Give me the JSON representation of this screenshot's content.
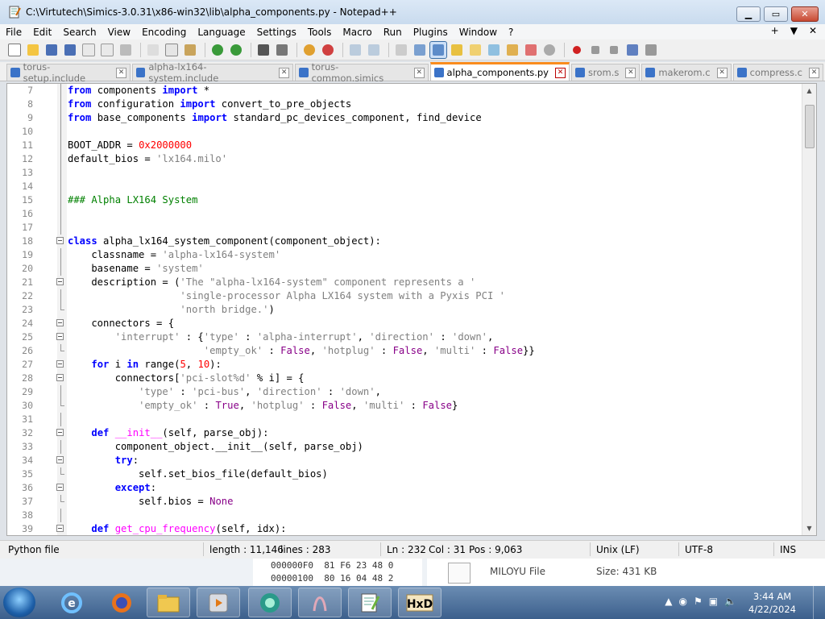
{
  "window": {
    "title": "C:\\Virtutech\\Simics-3.0.31\\x86-win32\\lib\\alpha_components.py - Notepad++"
  },
  "menu": [
    "File",
    "Edit",
    "Search",
    "View",
    "Encoding",
    "Language",
    "Settings",
    "Tools",
    "Macro",
    "Run",
    "Plugins",
    "Window",
    "?"
  ],
  "menu_right": [
    "+",
    "▼",
    "✕"
  ],
  "tabs": [
    {
      "label": "torus-setup.include",
      "active": false
    },
    {
      "label": "alpha-lx164-system.include",
      "active": false
    },
    {
      "label": "torus-common.simics",
      "active": false
    },
    {
      "label": "alpha_components.py",
      "active": true
    },
    {
      "label": "srom.s",
      "active": false
    },
    {
      "label": "makerom.c",
      "active": false
    },
    {
      "label": "compress.c",
      "active": false
    }
  ],
  "editor": {
    "lines": [
      {
        "n": "7",
        "fold": "line",
        "html": "<span class=\"kw\">from</span> components <span class=\"kw\">import</span> *"
      },
      {
        "n": "8",
        "fold": "line",
        "html": "<span class=\"kw\">from</span> configuration <span class=\"kw\">import</span> convert_to_pre_objects"
      },
      {
        "n": "9",
        "fold": "line",
        "html": "<span class=\"kw\">from</span> base_components <span class=\"kw\">import</span> standard_pc_devices_component, find_device"
      },
      {
        "n": "10",
        "fold": "line",
        "html": ""
      },
      {
        "n": "11",
        "fold": "line",
        "html": "BOOT_ADDR = <span class=\"num\">0x2000000</span>"
      },
      {
        "n": "12",
        "fold": "line",
        "html": "default_bios = <span class=\"str\">'lx164.milo'</span>"
      },
      {
        "n": "13",
        "fold": "line",
        "html": ""
      },
      {
        "n": "14",
        "fold": "line",
        "html": ""
      },
      {
        "n": "15",
        "fold": "line",
        "html": "<span class=\"cm\">### Alpha LX164 System</span>"
      },
      {
        "n": "16",
        "fold": "line",
        "html": ""
      },
      {
        "n": "17",
        "fold": "line",
        "html": ""
      },
      {
        "n": "18",
        "fold": "box",
        "html": "<span class=\"kw\">class</span> alpha_lx164_system_component(component_object):"
      },
      {
        "n": "19",
        "fold": "line",
        "html": "    classname = <span class=\"str\">'alpha-lx164-system'</span>"
      },
      {
        "n": "20",
        "fold": "line",
        "html": "    basename = <span class=\"str\">'system'</span>"
      },
      {
        "n": "21",
        "fold": "box",
        "html": "    description = (<span class=\"str\">'The \"alpha-lx164-system\" component represents a '</span>"
      },
      {
        "n": "22",
        "fold": "line",
        "html": "                   <span class=\"str\">'single-processor Alpha LX164 system with a Pyxis PCI '</span>"
      },
      {
        "n": "23",
        "fold": "end",
        "html": "                   <span class=\"str\">'north bridge.'</span>)"
      },
      {
        "n": "24",
        "fold": "box",
        "html": "    connectors = {"
      },
      {
        "n": "25",
        "fold": "box",
        "html": "        <span class=\"str\">'interrupt'</span> : {<span class=\"str\">'type'</span> : <span class=\"str\">'alpha-interrupt'</span>, <span class=\"str\">'direction'</span> : <span class=\"str\">'down'</span>,"
      },
      {
        "n": "26",
        "fold": "end",
        "html": "                       <span class=\"str\">'empty_ok'</span> : <span class=\"bool\">False</span>, <span class=\"str\">'hotplug'</span> : <span class=\"bool\">False</span>, <span class=\"str\">'multi'</span> : <span class=\"bool\">False</span>}}"
      },
      {
        "n": "27",
        "fold": "box",
        "html": "    <span class=\"kw\">for</span> i <span class=\"kw\">in</span> range(<span class=\"num\">5</span>, <span class=\"num\">10</span>):"
      },
      {
        "n": "28",
        "fold": "box",
        "html": "        connectors[<span class=\"str\">'pci-slot%d'</span> % i] = {"
      },
      {
        "n": "29",
        "fold": "line",
        "html": "            <span class=\"str\">'type'</span> : <span class=\"str\">'pci-bus'</span>, <span class=\"str\">'direction'</span> : <span class=\"str\">'down'</span>,"
      },
      {
        "n": "30",
        "fold": "end",
        "html": "            <span class=\"str\">'empty_ok'</span> : <span class=\"bool\">True</span>, <span class=\"str\">'hotplug'</span> : <span class=\"bool\">False</span>, <span class=\"str\">'multi'</span> : <span class=\"bool\">False</span>}"
      },
      {
        "n": "31",
        "fold": "line",
        "html": ""
      },
      {
        "n": "32",
        "fold": "box",
        "html": "    <span class=\"kw\">def</span> <span class=\"func\">__init__</span>(self, parse_obj):"
      },
      {
        "n": "33",
        "fold": "line",
        "html": "        component_object.__init__(self, parse_obj)"
      },
      {
        "n": "34",
        "fold": "box",
        "html": "        <span class=\"kw\">try</span>:"
      },
      {
        "n": "35",
        "fold": "end",
        "html": "            self.set_bios_file(default_bios)"
      },
      {
        "n": "36",
        "fold": "box",
        "html": "        <span class=\"kw\">except</span>:"
      },
      {
        "n": "37",
        "fold": "end",
        "html": "            self.bios = <span class=\"bool\">None</span>"
      },
      {
        "n": "38",
        "fold": "line",
        "html": ""
      },
      {
        "n": "39",
        "fold": "box",
        "html": "    <span class=\"kw\">def</span> <span class=\"func\">get_cpu_frequency</span>(self, idx):"
      }
    ]
  },
  "status": {
    "language": "Python file",
    "length": "length : 11,146",
    "lines": "lines : 283",
    "ln": "Ln : 232",
    "col": "Col : 31",
    "pos": "Pos : 9,063",
    "eol": "Unix (LF)",
    "encoding": "UTF-8",
    "mode": "INS"
  },
  "background": {
    "hex_line1": "000000F0  81 F6 23 48 0",
    "hex_line2": "00000100  80 16 04 48 2",
    "file_name": "MILOYU File",
    "file_size": "Size: 431 KB"
  },
  "taskbar": {
    "time": "3:44 AM",
    "date": "4/22/2024"
  }
}
